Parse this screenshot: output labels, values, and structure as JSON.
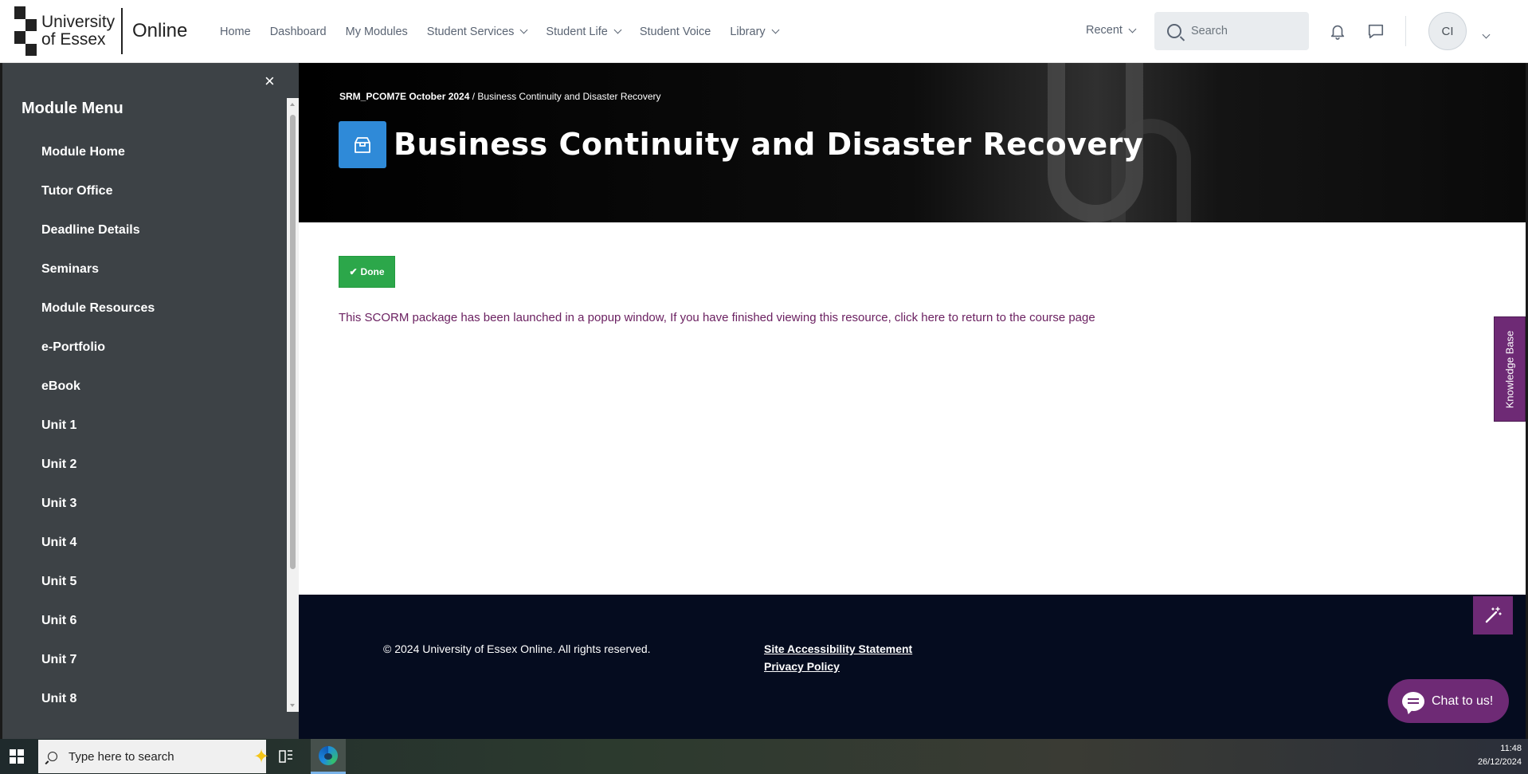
{
  "header": {
    "logo_text": "University of Essex",
    "logo_suffix": "Online",
    "nav": [
      {
        "label": "Home",
        "dropdown": false
      },
      {
        "label": "Dashboard",
        "dropdown": false
      },
      {
        "label": "My Modules",
        "dropdown": false
      },
      {
        "label": "Student Services",
        "dropdown": true
      },
      {
        "label": "Student Life",
        "dropdown": true
      },
      {
        "label": "Student Voice",
        "dropdown": false
      },
      {
        "label": "Library",
        "dropdown": true
      }
    ],
    "recent_label": "Recent",
    "search_placeholder": "Search",
    "avatar_initials": "CI"
  },
  "sidebar": {
    "close_symbol": "×",
    "title": "Module Menu",
    "items": [
      "Module Home",
      "Tutor Office",
      "Deadline Details",
      "Seminars",
      "Module Resources",
      "e-Portfolio",
      "eBook",
      "Unit 1",
      "Unit 2",
      "Unit 3",
      "Unit 4",
      "Unit 5",
      "Unit 6",
      "Unit 7",
      "Unit 8"
    ]
  },
  "banner": {
    "breadcrumb_course": "SRM_PCOM7E October 2024",
    "breadcrumb_sep": " / ",
    "breadcrumb_page": "Business Continuity and Disaster Recovery",
    "title": "Business Continuity and Disaster Recovery"
  },
  "content": {
    "done_label": "Done",
    "scorm_text_before": "This SCORM package has been launched in a popup window, If you have finished viewing this resource, ",
    "scorm_link": "click here to return to the course page"
  },
  "footer": {
    "copyright": "© 2024 University of Essex Online. All rights reserved.",
    "accessibility_link": "Site Accessibility Statement",
    "privacy_link": "Privacy Policy"
  },
  "widgets": {
    "knowledge_base": "Knowledge Base",
    "chat_label": "Chat to us!"
  },
  "taskbar": {
    "search_placeholder": "Type here to search",
    "time": "11:48",
    "date": "26/12/2024"
  },
  "colors": {
    "accent_purple": "#6e2a75",
    "done_green": "#2ca74a",
    "module_icon_blue": "#2f8ad8",
    "sidebar_bg": "#3d4246",
    "footer_bg": "#050c1f",
    "link_purple": "#6b2161"
  },
  "icons": [
    "checker-logo",
    "search-icon",
    "bell-icon",
    "chat-icon",
    "close-icon",
    "module-box-icon",
    "check-icon",
    "magic-wand-icon",
    "chat-bubble-icon",
    "windows-icon",
    "task-view-icon",
    "edge-icon"
  ]
}
